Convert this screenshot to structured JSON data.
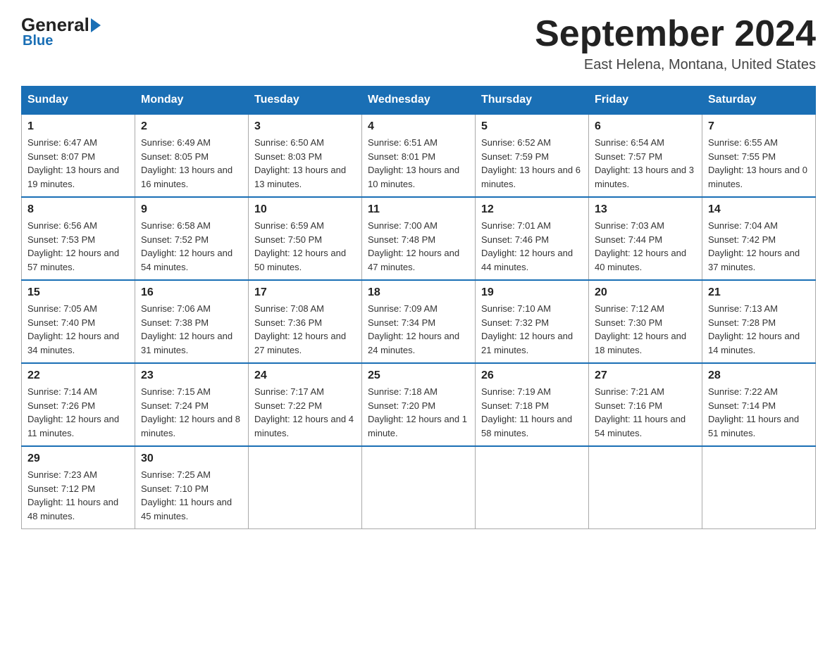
{
  "logo": {
    "text_general": "General",
    "text_blue": "Blue",
    "subtitle": "Blue"
  },
  "header": {
    "title": "September 2024",
    "location": "East Helena, Montana, United States"
  },
  "days_of_week": [
    "Sunday",
    "Monday",
    "Tuesday",
    "Wednesday",
    "Thursday",
    "Friday",
    "Saturday"
  ],
  "weeks": [
    [
      {
        "day": "1",
        "sunrise": "Sunrise: 6:47 AM",
        "sunset": "Sunset: 8:07 PM",
        "daylight": "Daylight: 13 hours and 19 minutes."
      },
      {
        "day": "2",
        "sunrise": "Sunrise: 6:49 AM",
        "sunset": "Sunset: 8:05 PM",
        "daylight": "Daylight: 13 hours and 16 minutes."
      },
      {
        "day": "3",
        "sunrise": "Sunrise: 6:50 AM",
        "sunset": "Sunset: 8:03 PM",
        "daylight": "Daylight: 13 hours and 13 minutes."
      },
      {
        "day": "4",
        "sunrise": "Sunrise: 6:51 AM",
        "sunset": "Sunset: 8:01 PM",
        "daylight": "Daylight: 13 hours and 10 minutes."
      },
      {
        "day": "5",
        "sunrise": "Sunrise: 6:52 AM",
        "sunset": "Sunset: 7:59 PM",
        "daylight": "Daylight: 13 hours and 6 minutes."
      },
      {
        "day": "6",
        "sunrise": "Sunrise: 6:54 AM",
        "sunset": "Sunset: 7:57 PM",
        "daylight": "Daylight: 13 hours and 3 minutes."
      },
      {
        "day": "7",
        "sunrise": "Sunrise: 6:55 AM",
        "sunset": "Sunset: 7:55 PM",
        "daylight": "Daylight: 13 hours and 0 minutes."
      }
    ],
    [
      {
        "day": "8",
        "sunrise": "Sunrise: 6:56 AM",
        "sunset": "Sunset: 7:53 PM",
        "daylight": "Daylight: 12 hours and 57 minutes."
      },
      {
        "day": "9",
        "sunrise": "Sunrise: 6:58 AM",
        "sunset": "Sunset: 7:52 PM",
        "daylight": "Daylight: 12 hours and 54 minutes."
      },
      {
        "day": "10",
        "sunrise": "Sunrise: 6:59 AM",
        "sunset": "Sunset: 7:50 PM",
        "daylight": "Daylight: 12 hours and 50 minutes."
      },
      {
        "day": "11",
        "sunrise": "Sunrise: 7:00 AM",
        "sunset": "Sunset: 7:48 PM",
        "daylight": "Daylight: 12 hours and 47 minutes."
      },
      {
        "day": "12",
        "sunrise": "Sunrise: 7:01 AM",
        "sunset": "Sunset: 7:46 PM",
        "daylight": "Daylight: 12 hours and 44 minutes."
      },
      {
        "day": "13",
        "sunrise": "Sunrise: 7:03 AM",
        "sunset": "Sunset: 7:44 PM",
        "daylight": "Daylight: 12 hours and 40 minutes."
      },
      {
        "day": "14",
        "sunrise": "Sunrise: 7:04 AM",
        "sunset": "Sunset: 7:42 PM",
        "daylight": "Daylight: 12 hours and 37 minutes."
      }
    ],
    [
      {
        "day": "15",
        "sunrise": "Sunrise: 7:05 AM",
        "sunset": "Sunset: 7:40 PM",
        "daylight": "Daylight: 12 hours and 34 minutes."
      },
      {
        "day": "16",
        "sunrise": "Sunrise: 7:06 AM",
        "sunset": "Sunset: 7:38 PM",
        "daylight": "Daylight: 12 hours and 31 minutes."
      },
      {
        "day": "17",
        "sunrise": "Sunrise: 7:08 AM",
        "sunset": "Sunset: 7:36 PM",
        "daylight": "Daylight: 12 hours and 27 minutes."
      },
      {
        "day": "18",
        "sunrise": "Sunrise: 7:09 AM",
        "sunset": "Sunset: 7:34 PM",
        "daylight": "Daylight: 12 hours and 24 minutes."
      },
      {
        "day": "19",
        "sunrise": "Sunrise: 7:10 AM",
        "sunset": "Sunset: 7:32 PM",
        "daylight": "Daylight: 12 hours and 21 minutes."
      },
      {
        "day": "20",
        "sunrise": "Sunrise: 7:12 AM",
        "sunset": "Sunset: 7:30 PM",
        "daylight": "Daylight: 12 hours and 18 minutes."
      },
      {
        "day": "21",
        "sunrise": "Sunrise: 7:13 AM",
        "sunset": "Sunset: 7:28 PM",
        "daylight": "Daylight: 12 hours and 14 minutes."
      }
    ],
    [
      {
        "day": "22",
        "sunrise": "Sunrise: 7:14 AM",
        "sunset": "Sunset: 7:26 PM",
        "daylight": "Daylight: 12 hours and 11 minutes."
      },
      {
        "day": "23",
        "sunrise": "Sunrise: 7:15 AM",
        "sunset": "Sunset: 7:24 PM",
        "daylight": "Daylight: 12 hours and 8 minutes."
      },
      {
        "day": "24",
        "sunrise": "Sunrise: 7:17 AM",
        "sunset": "Sunset: 7:22 PM",
        "daylight": "Daylight: 12 hours and 4 minutes."
      },
      {
        "day": "25",
        "sunrise": "Sunrise: 7:18 AM",
        "sunset": "Sunset: 7:20 PM",
        "daylight": "Daylight: 12 hours and 1 minute."
      },
      {
        "day": "26",
        "sunrise": "Sunrise: 7:19 AM",
        "sunset": "Sunset: 7:18 PM",
        "daylight": "Daylight: 11 hours and 58 minutes."
      },
      {
        "day": "27",
        "sunrise": "Sunrise: 7:21 AM",
        "sunset": "Sunset: 7:16 PM",
        "daylight": "Daylight: 11 hours and 54 minutes."
      },
      {
        "day": "28",
        "sunrise": "Sunrise: 7:22 AM",
        "sunset": "Sunset: 7:14 PM",
        "daylight": "Daylight: 11 hours and 51 minutes."
      }
    ],
    [
      {
        "day": "29",
        "sunrise": "Sunrise: 7:23 AM",
        "sunset": "Sunset: 7:12 PM",
        "daylight": "Daylight: 11 hours and 48 minutes."
      },
      {
        "day": "30",
        "sunrise": "Sunrise: 7:25 AM",
        "sunset": "Sunset: 7:10 PM",
        "daylight": "Daylight: 11 hours and 45 minutes."
      },
      null,
      null,
      null,
      null,
      null
    ]
  ]
}
